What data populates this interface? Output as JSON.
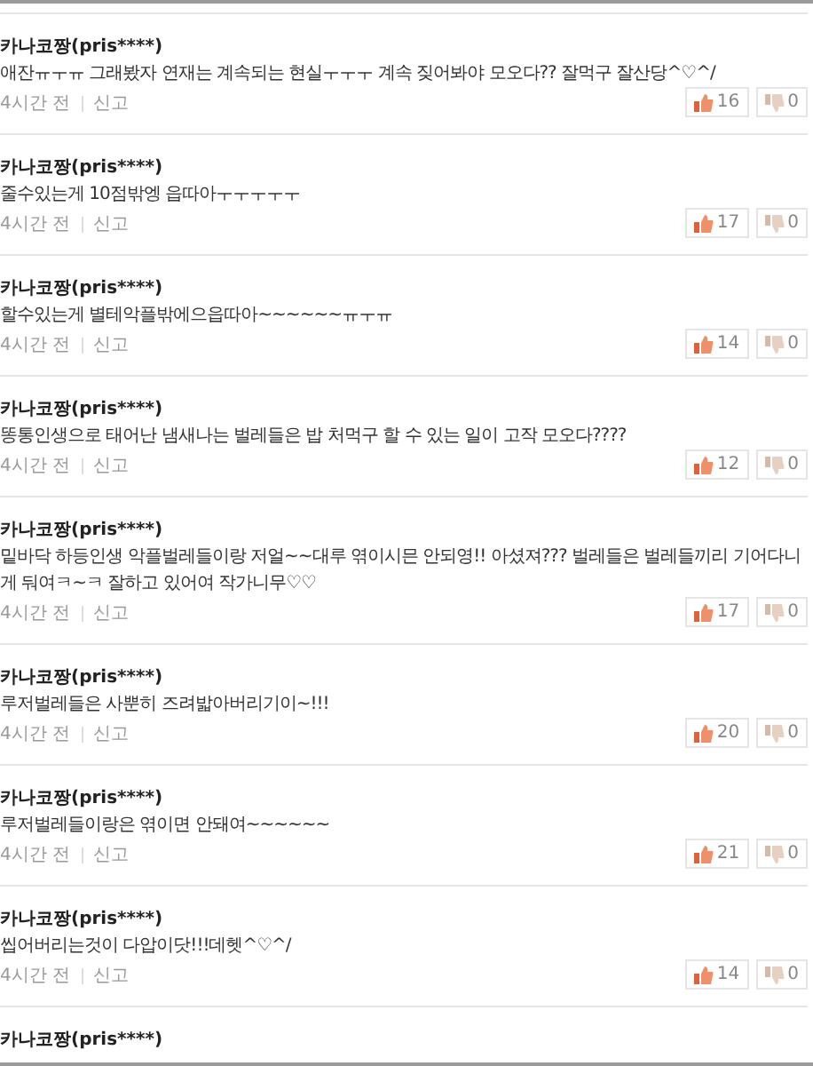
{
  "comments": [
    {
      "author": "카나코짱(pris****)",
      "text": "애잔ㅠㅜㅠ 그래봤자 연재는 계속되는 현실ㅜㅜㅜ 계속 짖어봐야 모오다?? 잘먹구 잘산당^♡^/",
      "time": "4시간 전",
      "report": "신고",
      "likes": "16",
      "dislikes": "0"
    },
    {
      "author": "카나코짱(pris****)",
      "text": "줄수있는게 10점밖엥 읍따아ㅜㅜㅜㅜㅜ",
      "time": "4시간 전",
      "report": "신고",
      "likes": "17",
      "dislikes": "0"
    },
    {
      "author": "카나코짱(pris****)",
      "text": "할수있는게 별테악플밖에으읍따아~~~~~~ㅠㅜㅠ",
      "time": "4시간 전",
      "report": "신고",
      "likes": "14",
      "dislikes": "0"
    },
    {
      "author": "카나코짱(pris****)",
      "text": "똥통인생으로 태어난 냄새나는 벌레들은 밥 처먹구 할 수 있는 일이 고작 모오다????",
      "time": "4시간 전",
      "report": "신고",
      "likes": "12",
      "dislikes": "0"
    },
    {
      "author": "카나코짱(pris****)",
      "text": "밑바닥 하등인생 악플벌레들이랑 저얼~~대루 엮이시믄 안되영!! 아셨져??? 벌레들은 벌레들끼리 기어다니게 둬여ㅋ~ㅋ 잘하고 있어여 작가니무♡♡",
      "time": "4시간 전",
      "report": "신고",
      "likes": "17",
      "dislikes": "0"
    },
    {
      "author": "카나코짱(pris****)",
      "text": "루저벌레들은 사뿐히 즈려밟아버리기이~!!!",
      "time": "4시간 전",
      "report": "신고",
      "likes": "20",
      "dislikes": "0"
    },
    {
      "author": "카나코짱(pris****)",
      "text": "루저벌레들이랑은 엮이면 안돼여~~~~~~",
      "time": "4시간 전",
      "report": "신고",
      "likes": "21",
      "dislikes": "0"
    },
    {
      "author": "카나코짱(pris****)",
      "text": "씹어버리는것이 다압이닷!!!데헷^♡^/",
      "time": "4시간 전",
      "report": "신고",
      "likes": "14",
      "dislikes": "0"
    },
    {
      "author": "카나코짱(pris****)"
    }
  ]
}
